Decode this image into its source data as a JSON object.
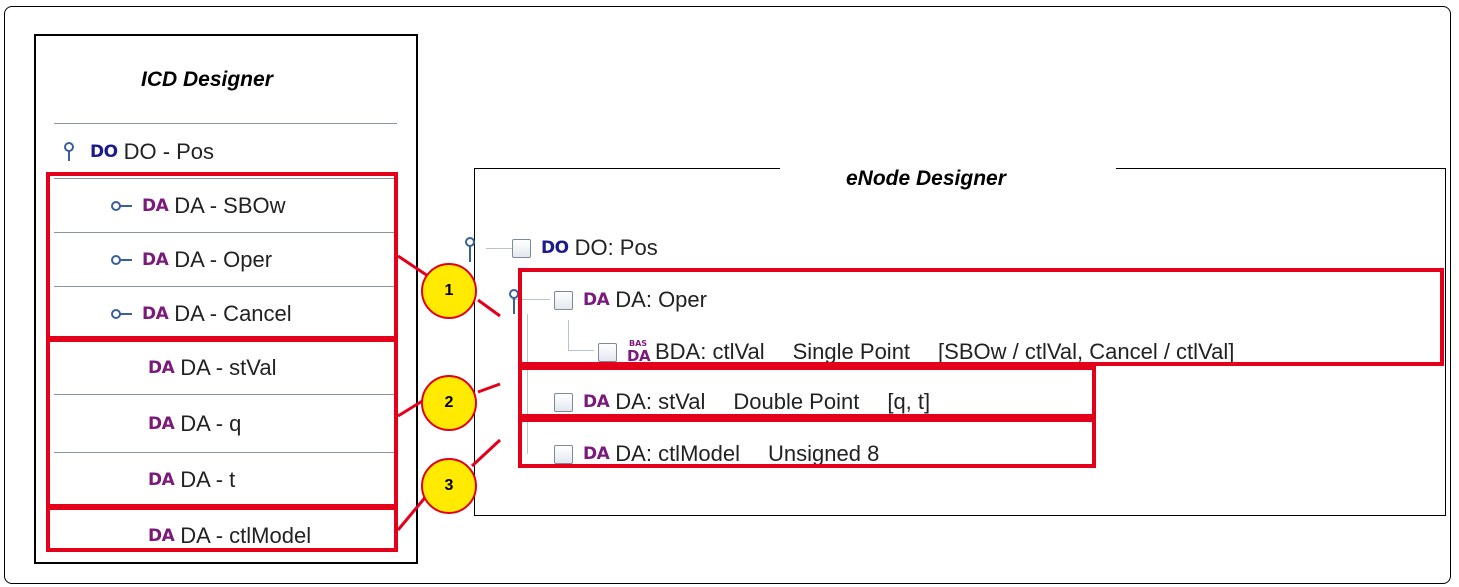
{
  "icd": {
    "title": "ICD Designer",
    "rows": [
      {
        "badge": "DO",
        "label": "DO - Pos"
      },
      {
        "badge": "DA",
        "label": "DA - SBOw"
      },
      {
        "badge": "DA",
        "label": "DA - Oper"
      },
      {
        "badge": "DA",
        "label": "DA - Cancel"
      },
      {
        "badge": "DA",
        "label": "DA - stVal"
      },
      {
        "badge": "DA",
        "label": "DA - q"
      },
      {
        "badge": "DA",
        "label": "DA - t"
      },
      {
        "badge": "DA",
        "label": "DA - ctlModel"
      }
    ]
  },
  "enode": {
    "title": "eNode Designer",
    "rows": [
      {
        "badge": "DO",
        "label": "DO: Pos",
        "type": "",
        "refs": ""
      },
      {
        "badge": "DA",
        "label": "DA: Oper",
        "type": "",
        "refs": ""
      },
      {
        "badge_top": "BAS",
        "badge": "DA",
        "label": "BDA: ctlVal",
        "type": "Single Point",
        "refs": "[SBOw / ctlVal, Cancel / ctlVal]"
      },
      {
        "badge": "DA",
        "label": "DA: stVal",
        "type": "Double Point",
        "refs": "[q, t]"
      },
      {
        "badge": "DA",
        "label": "DA: ctlModel",
        "type": "Unsigned 8",
        "refs": ""
      }
    ]
  },
  "callouts": [
    "1",
    "2",
    "3"
  ],
  "colors": {
    "highlight": "#e2001a",
    "callout_fill": "#ffea00",
    "do_badge": "#1b1b8c",
    "da_badge": "#7a1a7a"
  }
}
